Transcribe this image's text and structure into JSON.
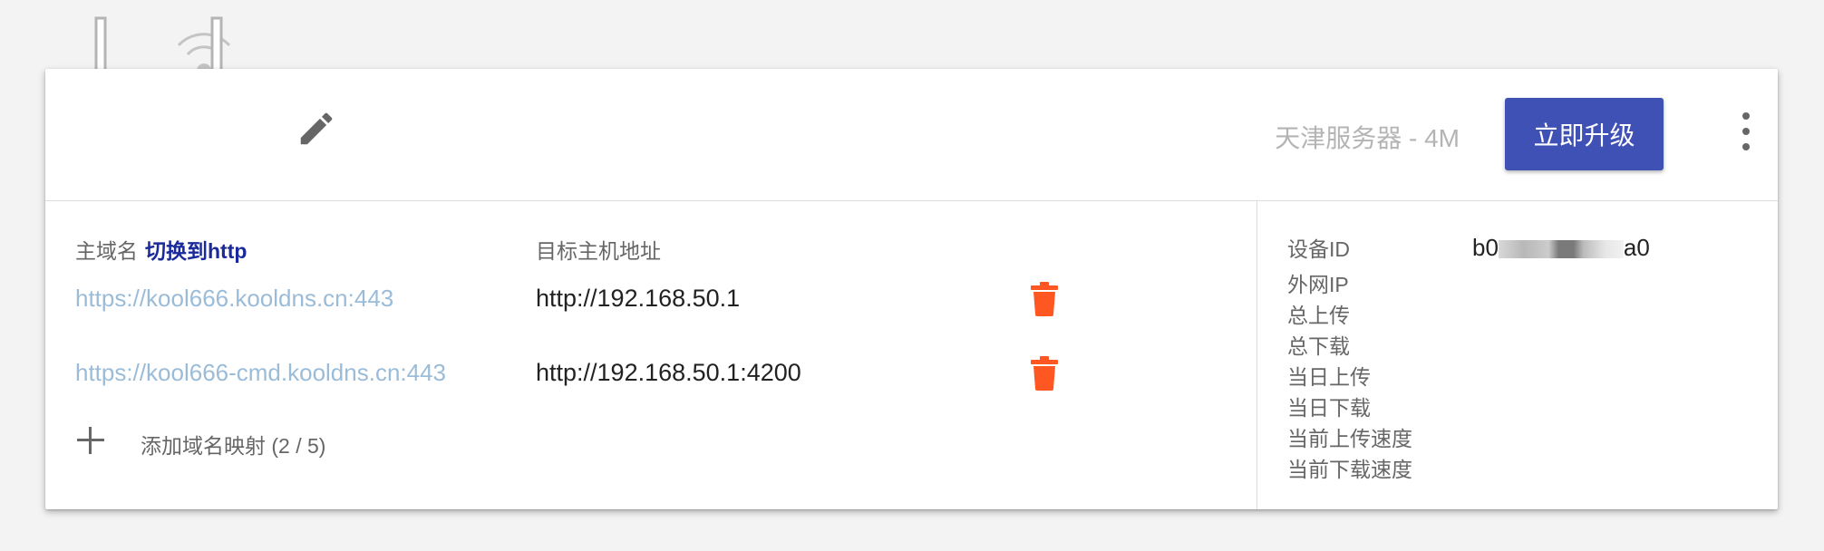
{
  "header": {
    "server_label": "天津服务器 - 4M",
    "upgrade_label": "立即升级",
    "icons": [
      "router-icon",
      "edit-icon",
      "more-vert-icon"
    ]
  },
  "mappings": {
    "domain_header": "主域名",
    "switch_label": "切换到http",
    "target_header": "目标主机地址",
    "rows": [
      {
        "domain": "https://kool666.kooldns.cn:443",
        "target": "http://192.168.50.1"
      },
      {
        "domain": "https://kool666-cmd.kooldns.cn:443",
        "target": "http://192.168.50.1:4200"
      }
    ],
    "add_label": "添加域名映射 (2 / 5)"
  },
  "stats": {
    "device_id_label": "设备ID",
    "device_id_prefix": "b0",
    "device_id_suffix": "a0",
    "labels": [
      "外网IP",
      "总上传",
      "总下载",
      "当日上传",
      "当日下载",
      "当前上传速度",
      "当前下载速度"
    ]
  },
  "colors": {
    "accent": "#3f51b5",
    "link": "#9bbcd8",
    "switch": "#1a2a9a",
    "delete": "#ff5722"
  }
}
